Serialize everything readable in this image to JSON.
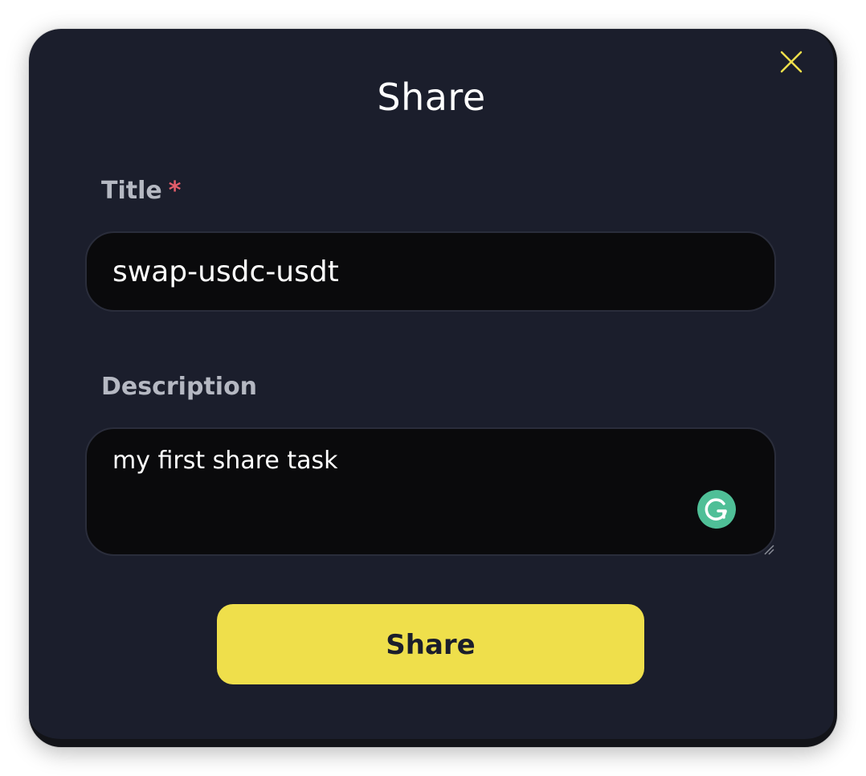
{
  "dialog": {
    "title": "Share",
    "close_icon": "close-icon",
    "accent_color": "#efdf4b",
    "background_color": "#1b1e2c"
  },
  "form": {
    "title_field": {
      "label": "Title",
      "required_marker": "*",
      "value": "swap-usdc-usdt"
    },
    "description_field": {
      "label": "Description",
      "value": "my first share task",
      "assistant_icon": "grammarly-icon"
    }
  },
  "actions": {
    "share_label": "Share"
  }
}
